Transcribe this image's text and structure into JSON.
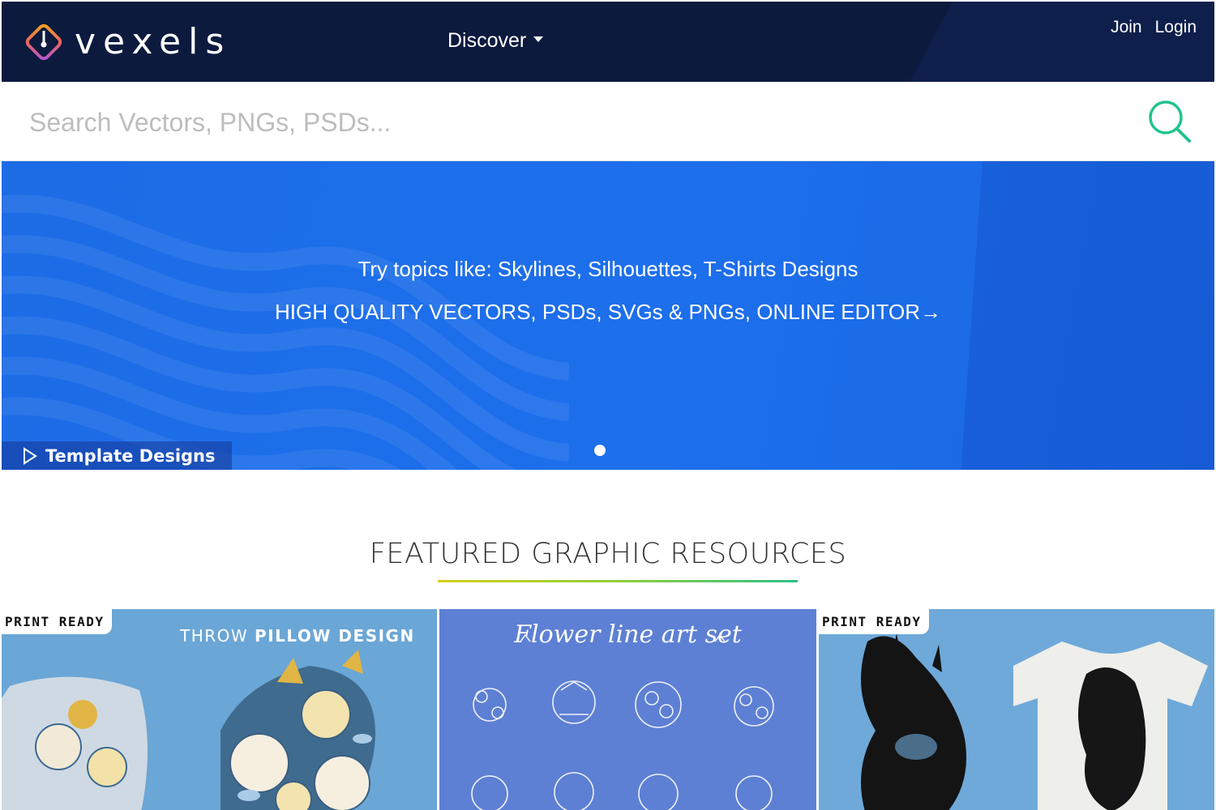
{
  "header": {
    "brand": "vexels",
    "nav_discover": "Discover",
    "join": "Join",
    "login": "Login"
  },
  "search": {
    "placeholder": "Search Vectors, PNGs, PSDs..."
  },
  "hero": {
    "topics_line": "Try topics like: Skylines, Silhouettes, T-Shirts Designs",
    "tagline": "HIGH QUALITY VECTORS, PSDs, SVGs & PNGs, ONLINE EDITOR→",
    "template_link": "Template Designs"
  },
  "featured": {
    "title": "FEATURED GRAPHIC RESOURCES",
    "cards": [
      {
        "badge": "PRINT READY",
        "title_light": "THROW ",
        "title_bold": "PILLOW DESIGN"
      },
      {
        "title": "Flower line art set"
      },
      {
        "badge": "PRINT READY"
      }
    ]
  },
  "colors": {
    "header_bg": "#0c1a3e",
    "hero_blue": "#1d6ce6",
    "search_accent": "#22c38e"
  },
  "icons": [
    "vexels-logo-icon",
    "chevron-down-icon",
    "search-icon",
    "play-icon"
  ]
}
